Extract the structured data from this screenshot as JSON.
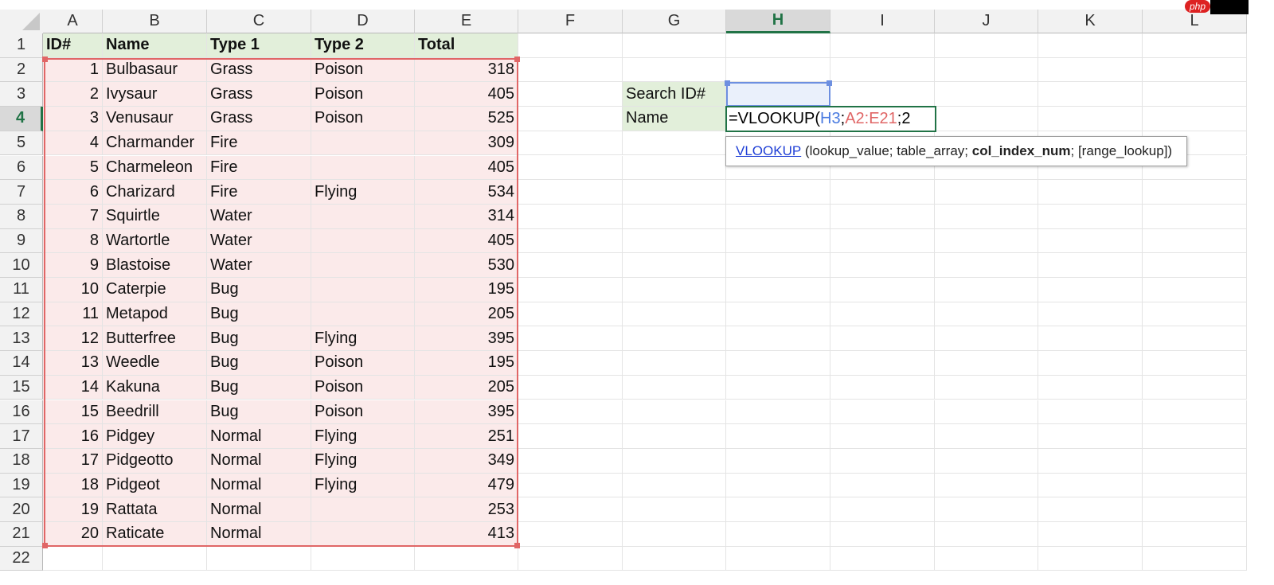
{
  "columns": [
    "A",
    "B",
    "C",
    "D",
    "E",
    "F",
    "G",
    "H",
    "I",
    "J",
    "K",
    "L"
  ],
  "rows": [
    "1",
    "2",
    "3",
    "4",
    "5",
    "6",
    "7",
    "8",
    "9",
    "10",
    "11",
    "12",
    "13",
    "14",
    "15",
    "16",
    "17",
    "18",
    "19",
    "20",
    "21",
    "22"
  ],
  "table": {
    "headers": [
      "ID#",
      "Name",
      "Type 1",
      "Type 2",
      "Total"
    ],
    "rows": [
      [
        "1",
        "Bulbasaur",
        "Grass",
        "Poison",
        "318"
      ],
      [
        "2",
        "Ivysaur",
        "Grass",
        "Poison",
        "405"
      ],
      [
        "3",
        "Venusaur",
        "Grass",
        "Poison",
        "525"
      ],
      [
        "4",
        "Charmander",
        "Fire",
        "",
        "309"
      ],
      [
        "5",
        "Charmeleon",
        "Fire",
        "",
        "405"
      ],
      [
        "6",
        "Charizard",
        "Fire",
        "Flying",
        "534"
      ],
      [
        "7",
        "Squirtle",
        "Water",
        "",
        "314"
      ],
      [
        "8",
        "Wartortle",
        "Water",
        "",
        "405"
      ],
      [
        "9",
        "Blastoise",
        "Water",
        "",
        "530"
      ],
      [
        "10",
        "Caterpie",
        "Bug",
        "",
        "195"
      ],
      [
        "11",
        "Metapod",
        "Bug",
        "",
        "205"
      ],
      [
        "12",
        "Butterfree",
        "Bug",
        "Flying",
        "395"
      ],
      [
        "13",
        "Weedle",
        "Bug",
        "Poison",
        "195"
      ],
      [
        "14",
        "Kakuna",
        "Bug",
        "Poison",
        "205"
      ],
      [
        "15",
        "Beedrill",
        "Bug",
        "Poison",
        "395"
      ],
      [
        "16",
        "Pidgey",
        "Normal",
        "Flying",
        "251"
      ],
      [
        "17",
        "Pidgeotto",
        "Normal",
        "Flying",
        "349"
      ],
      [
        "18",
        "Pidgeot",
        "Normal",
        "Flying",
        "479"
      ],
      [
        "19",
        "Rattata",
        "Normal",
        "",
        "253"
      ],
      [
        "20",
        "Raticate",
        "Normal",
        "",
        "413"
      ]
    ]
  },
  "lookup": {
    "search_label": "Search ID#",
    "name_label": "Name",
    "search_value": ""
  },
  "formula": {
    "prefix": "=VLOOKUP(",
    "ref1": "H3",
    "sep1": ";",
    "ref2": "A2:E21",
    "sep2": ";",
    "arg3": "2"
  },
  "tooltip": {
    "func": "VLOOKUP",
    "open": " (lookup_value; table_array; ",
    "bold": "col_index_num",
    "close": "; [range_lookup])"
  },
  "badge": "php",
  "colors": {
    "header_green": "#e2efda",
    "table_pink": "#fbeaea",
    "range_red": "#e06666",
    "ref_blue": "#4a7be0",
    "excel_green": "#217346"
  }
}
